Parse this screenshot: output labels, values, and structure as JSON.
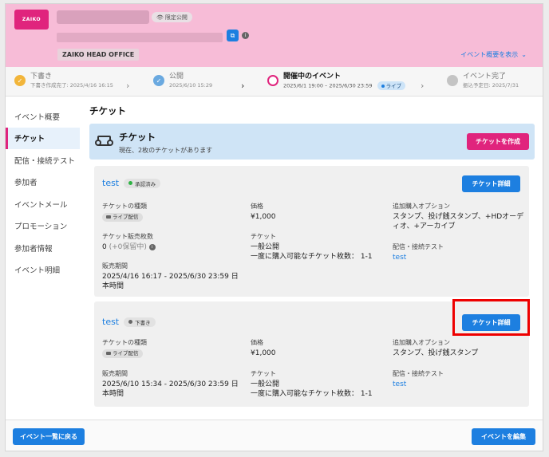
{
  "header": {
    "logo_text": "ZAIKO",
    "visibility_badge": "限定公開",
    "organization": "ZAIKO HEAD OFFICE",
    "show_overview": "イベント概要を表示"
  },
  "stepper": {
    "steps": [
      {
        "title": "下書き",
        "sub": "下書き作成完了: 2025/4/16 16:15"
      },
      {
        "title": "公開",
        "sub": "2025/6/10 15:29"
      },
      {
        "title": "開催中のイベント",
        "sub": "2025/6/1 19:00 – 2025/6/30 23:59",
        "badge": "ライブ"
      },
      {
        "title": "イベント完了",
        "sub": "振込予定日: 2025/7/31"
      }
    ]
  },
  "sidebar": {
    "items": [
      {
        "label": "イベント概要"
      },
      {
        "label": "チケット"
      },
      {
        "label": "配信・接続テスト"
      },
      {
        "label": "参加者"
      },
      {
        "label": "イベントメール"
      },
      {
        "label": "プロモーション"
      },
      {
        "label": "参加者情報"
      },
      {
        "label": "イベント明細"
      }
    ]
  },
  "main": {
    "title": "チケット",
    "banner": {
      "title": "チケット",
      "subtitle": "現在、2枚のチケットがあります",
      "create_label": "チケットを作成"
    },
    "labels": {
      "ticket_type": "チケットの種類",
      "price": "価格",
      "options": "追加購入オプション",
      "sales_count": "チケット販売枚数",
      "ticket": "チケット",
      "stream_test": "配信・接続テスト",
      "sales_period": "販売期間",
      "detail_button": "チケット詳細"
    },
    "tickets": [
      {
        "name": "test",
        "status": "承認済み",
        "type_chip": "ライブ配信",
        "price": "¥1,000",
        "options": "スタンプ、投げ銭スタンプ、+HDオーディオ、+アーカイブ",
        "sales_count": "0",
        "reserved": "(+0保留中)",
        "ticket_line1": "一般公開",
        "ticket_line2": "一度に購入可能なチケット枚数： 1-1",
        "stream_link": "test",
        "sales_period": "2025/4/16 16:17 - 2025/6/30 23:59 日本時間"
      },
      {
        "name": "test",
        "status": "下書き",
        "type_chip": "ライブ配信",
        "price": "¥1,000",
        "options": "スタンプ、投げ銭スタンプ",
        "ticket_line1": "一般公開",
        "ticket_line2": "一度に購入可能なチケット枚数： 1-1",
        "stream_link": "test",
        "sales_period": "2025/6/10 15:34 - 2025/6/30 23:59 日本時間"
      }
    ]
  },
  "footer": {
    "back_label": "イベント一覧に戻る",
    "edit_label": "イベントを編集"
  },
  "colors": {
    "brand_pink": "#e0247d",
    "header_pink": "#f7bcd7",
    "primary_blue": "#1d7fe0",
    "banner_blue": "#cfe4f6",
    "approved_green": "#2fb344",
    "draft_gray": "#666666",
    "step_done_yellow": "#f2b53a",
    "step_done_blue": "#6aa9e0",
    "highlight_red": "#ee0000"
  }
}
